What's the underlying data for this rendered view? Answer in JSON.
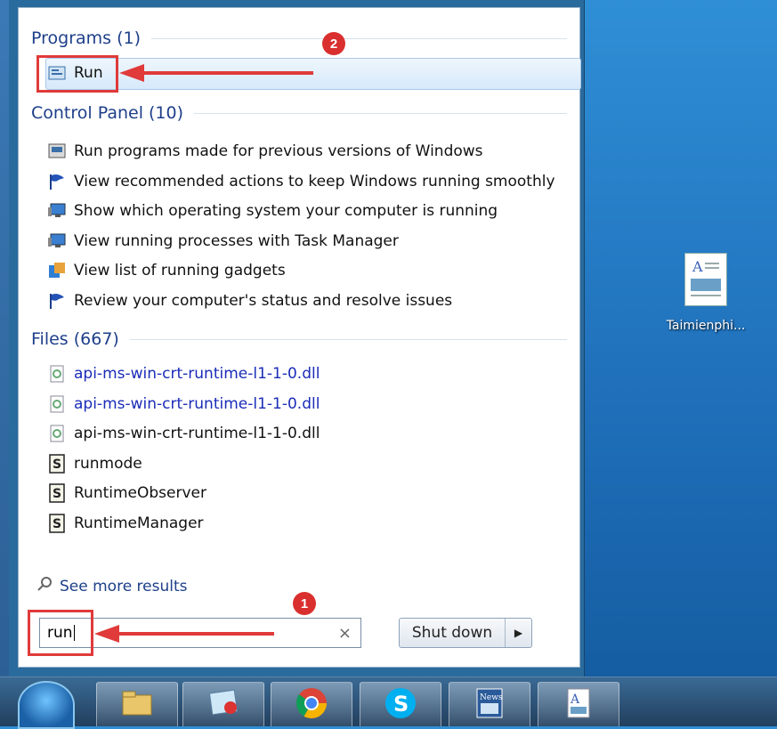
{
  "start_menu": {
    "groups": {
      "programs": {
        "header": "Programs (1)"
      },
      "control_panel": {
        "header": "Control Panel (10)"
      },
      "files": {
        "header": "Files (667)"
      }
    },
    "run_item": {
      "label": "Run",
      "icon": "run-icon"
    },
    "control_panel_items": [
      {
        "label": "Run programs made for previous versions of Windows",
        "icon": "compat-icon"
      },
      {
        "label": "View recommended actions to keep Windows running smoothly",
        "icon": "flag-icon"
      },
      {
        "label": "Show which operating system your computer is running",
        "icon": "monitor-icon"
      },
      {
        "label": "View running processes with Task Manager",
        "icon": "monitor-icon"
      },
      {
        "label": "View list of running gadgets",
        "icon": "gadget-icon"
      },
      {
        "label": "Review your computer's status and resolve issues",
        "icon": "flag-icon"
      }
    ],
    "file_items": [
      {
        "label": "api-ms-win-crt-runtime-l1-1-0.dll",
        "icon": "dll-icon",
        "color": "#1a2cb8"
      },
      {
        "label": "api-ms-win-crt-runtime-l1-1-0.dll",
        "icon": "dll-icon",
        "color": "#1a2cb8"
      },
      {
        "label": "api-ms-win-crt-runtime-l1-1-0.dll",
        "icon": "dll-icon",
        "color": "#111111"
      },
      {
        "label": "runmode",
        "icon": "script-icon"
      },
      {
        "label": "RuntimeObserver",
        "icon": "script-icon"
      },
      {
        "label": "RuntimeManager",
        "icon": "script-icon"
      }
    ],
    "see_more": "See more results",
    "search": {
      "value": "run"
    },
    "shutdown_label": "Shut down"
  },
  "annotations": {
    "badge1": "1",
    "badge2": "2",
    "color": "#e03a3a"
  },
  "desktop": {
    "icon_label": "Taimienphi..."
  },
  "taskbar": {
    "items": [
      "explorer-icon",
      "photo-icon",
      "chrome-icon",
      "skype-icon",
      "news-icon",
      "document-icon"
    ]
  }
}
